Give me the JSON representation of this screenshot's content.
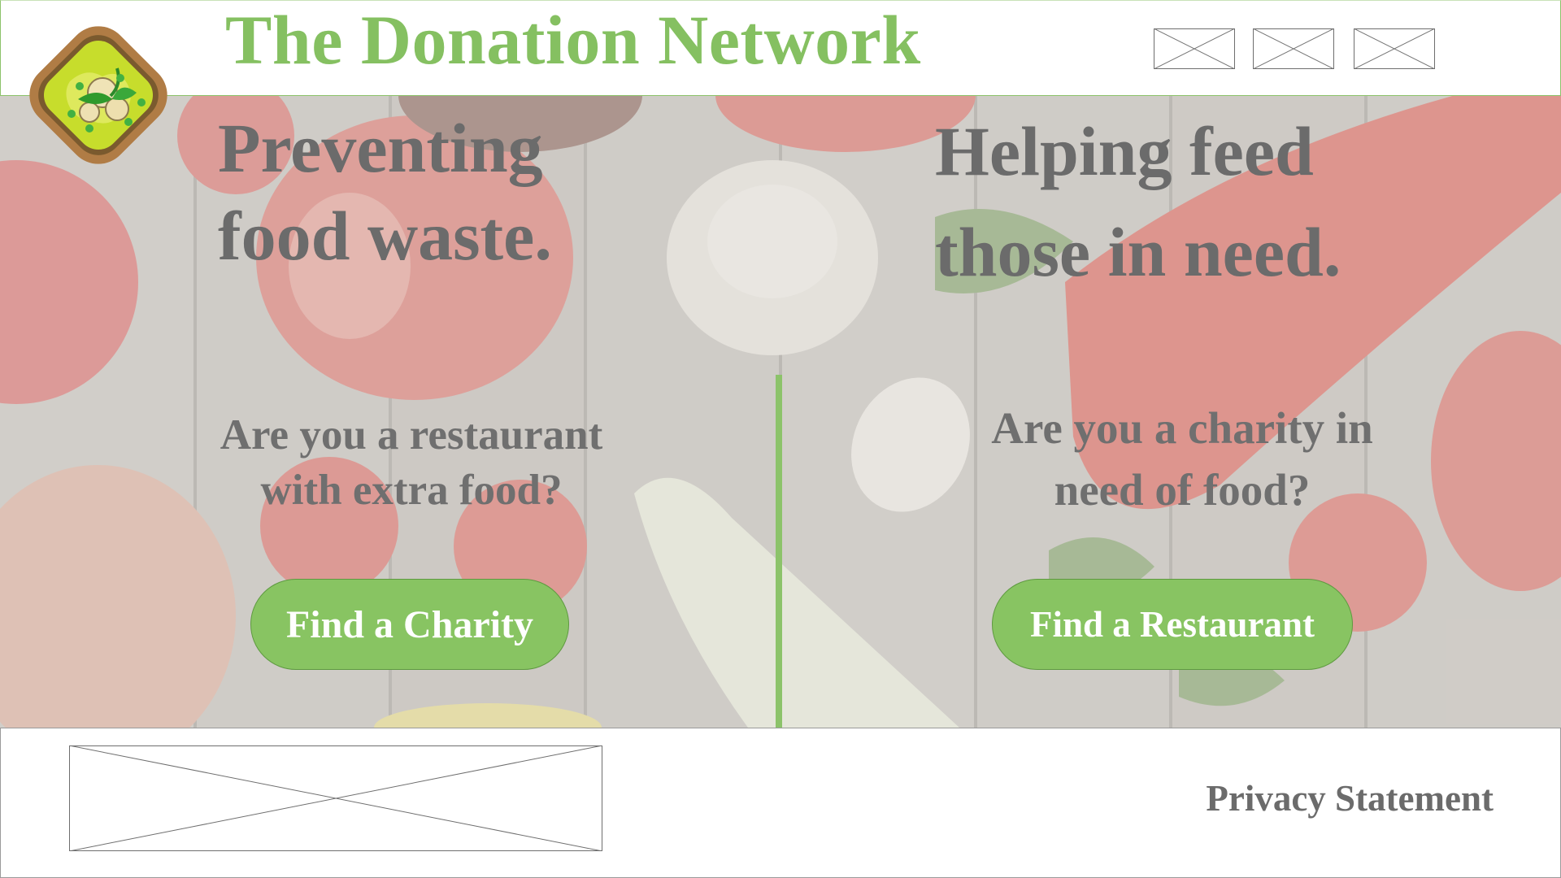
{
  "header": {
    "title": "The Donation Network",
    "logo_icon": "food-bowl-logo-icon",
    "placeholder_icons": [
      "image-placeholder-icon",
      "image-placeholder-icon",
      "image-placeholder-icon"
    ]
  },
  "hero": {
    "left": {
      "headline_line1": "Preventing",
      "headline_line2": "food waste.",
      "question_line1": "Are you a restaurant",
      "question_line2": "with extra food?",
      "button_label": "Find a Charity"
    },
    "right": {
      "headline_line1": "Helping feed",
      "headline_line2": "those in need.",
      "question_line1": "Are you a charity in",
      "question_line2": "need of food?",
      "button_label": "Find a Restaurant"
    }
  },
  "footer": {
    "privacy_label": "Privacy Statement",
    "placeholder_icon": "image-placeholder-icon"
  },
  "colors": {
    "accent_green": "#88c462",
    "title_green": "#85c061",
    "text_gray": "#6b6b6b"
  }
}
